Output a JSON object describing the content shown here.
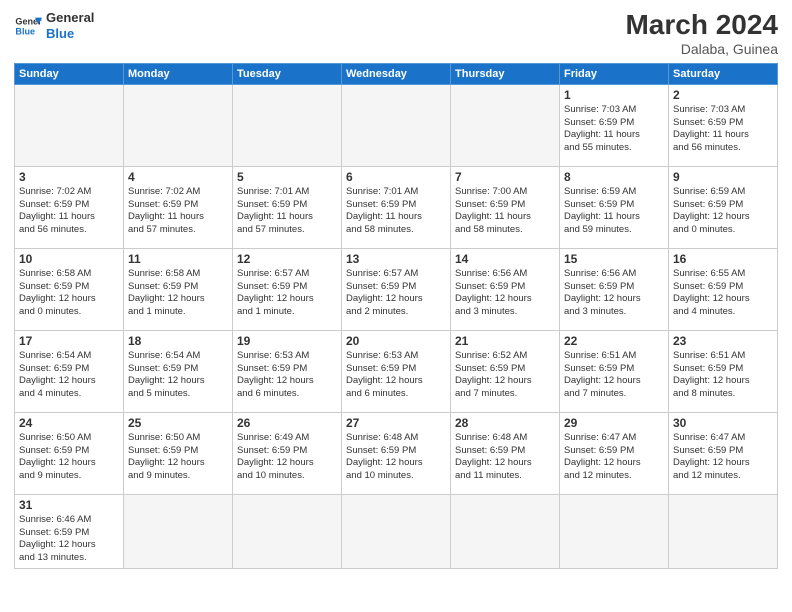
{
  "logo": {
    "general": "General",
    "blue": "Blue"
  },
  "title": "March 2024",
  "subtitle": "Dalaba, Guinea",
  "days_of_week": [
    "Sunday",
    "Monday",
    "Tuesday",
    "Wednesday",
    "Thursday",
    "Friday",
    "Saturday"
  ],
  "weeks": [
    [
      {
        "day": "",
        "info": ""
      },
      {
        "day": "",
        "info": ""
      },
      {
        "day": "",
        "info": ""
      },
      {
        "day": "",
        "info": ""
      },
      {
        "day": "",
        "info": ""
      },
      {
        "day": "1",
        "info": "Sunrise: 7:03 AM\nSunset: 6:59 PM\nDaylight: 11 hours\nand 55 minutes."
      },
      {
        "day": "2",
        "info": "Sunrise: 7:03 AM\nSunset: 6:59 PM\nDaylight: 11 hours\nand 56 minutes."
      }
    ],
    [
      {
        "day": "3",
        "info": "Sunrise: 7:02 AM\nSunset: 6:59 PM\nDaylight: 11 hours\nand 56 minutes."
      },
      {
        "day": "4",
        "info": "Sunrise: 7:02 AM\nSunset: 6:59 PM\nDaylight: 11 hours\nand 57 minutes."
      },
      {
        "day": "5",
        "info": "Sunrise: 7:01 AM\nSunset: 6:59 PM\nDaylight: 11 hours\nand 57 minutes."
      },
      {
        "day": "6",
        "info": "Sunrise: 7:01 AM\nSunset: 6:59 PM\nDaylight: 11 hours\nand 58 minutes."
      },
      {
        "day": "7",
        "info": "Sunrise: 7:00 AM\nSunset: 6:59 PM\nDaylight: 11 hours\nand 58 minutes."
      },
      {
        "day": "8",
        "info": "Sunrise: 6:59 AM\nSunset: 6:59 PM\nDaylight: 11 hours\nand 59 minutes."
      },
      {
        "day": "9",
        "info": "Sunrise: 6:59 AM\nSunset: 6:59 PM\nDaylight: 12 hours\nand 0 minutes."
      }
    ],
    [
      {
        "day": "10",
        "info": "Sunrise: 6:58 AM\nSunset: 6:59 PM\nDaylight: 12 hours\nand 0 minutes."
      },
      {
        "day": "11",
        "info": "Sunrise: 6:58 AM\nSunset: 6:59 PM\nDaylight: 12 hours\nand 1 minute."
      },
      {
        "day": "12",
        "info": "Sunrise: 6:57 AM\nSunset: 6:59 PM\nDaylight: 12 hours\nand 1 minute."
      },
      {
        "day": "13",
        "info": "Sunrise: 6:57 AM\nSunset: 6:59 PM\nDaylight: 12 hours\nand 2 minutes."
      },
      {
        "day": "14",
        "info": "Sunrise: 6:56 AM\nSunset: 6:59 PM\nDaylight: 12 hours\nand 3 minutes."
      },
      {
        "day": "15",
        "info": "Sunrise: 6:56 AM\nSunset: 6:59 PM\nDaylight: 12 hours\nand 3 minutes."
      },
      {
        "day": "16",
        "info": "Sunrise: 6:55 AM\nSunset: 6:59 PM\nDaylight: 12 hours\nand 4 minutes."
      }
    ],
    [
      {
        "day": "17",
        "info": "Sunrise: 6:54 AM\nSunset: 6:59 PM\nDaylight: 12 hours\nand 4 minutes."
      },
      {
        "day": "18",
        "info": "Sunrise: 6:54 AM\nSunset: 6:59 PM\nDaylight: 12 hours\nand 5 minutes."
      },
      {
        "day": "19",
        "info": "Sunrise: 6:53 AM\nSunset: 6:59 PM\nDaylight: 12 hours\nand 6 minutes."
      },
      {
        "day": "20",
        "info": "Sunrise: 6:53 AM\nSunset: 6:59 PM\nDaylight: 12 hours\nand 6 minutes."
      },
      {
        "day": "21",
        "info": "Sunrise: 6:52 AM\nSunset: 6:59 PM\nDaylight: 12 hours\nand 7 minutes."
      },
      {
        "day": "22",
        "info": "Sunrise: 6:51 AM\nSunset: 6:59 PM\nDaylight: 12 hours\nand 7 minutes."
      },
      {
        "day": "23",
        "info": "Sunrise: 6:51 AM\nSunset: 6:59 PM\nDaylight: 12 hours\nand 8 minutes."
      }
    ],
    [
      {
        "day": "24",
        "info": "Sunrise: 6:50 AM\nSunset: 6:59 PM\nDaylight: 12 hours\nand 9 minutes."
      },
      {
        "day": "25",
        "info": "Sunrise: 6:50 AM\nSunset: 6:59 PM\nDaylight: 12 hours\nand 9 minutes."
      },
      {
        "day": "26",
        "info": "Sunrise: 6:49 AM\nSunset: 6:59 PM\nDaylight: 12 hours\nand 10 minutes."
      },
      {
        "day": "27",
        "info": "Sunrise: 6:48 AM\nSunset: 6:59 PM\nDaylight: 12 hours\nand 10 minutes."
      },
      {
        "day": "28",
        "info": "Sunrise: 6:48 AM\nSunset: 6:59 PM\nDaylight: 12 hours\nand 11 minutes."
      },
      {
        "day": "29",
        "info": "Sunrise: 6:47 AM\nSunset: 6:59 PM\nDaylight: 12 hours\nand 12 minutes."
      },
      {
        "day": "30",
        "info": "Sunrise: 6:47 AM\nSunset: 6:59 PM\nDaylight: 12 hours\nand 12 minutes."
      }
    ],
    [
      {
        "day": "31",
        "info": "Sunrise: 6:46 AM\nSunset: 6:59 PM\nDaylight: 12 hours\nand 13 minutes."
      },
      {
        "day": "",
        "info": ""
      },
      {
        "day": "",
        "info": ""
      },
      {
        "day": "",
        "info": ""
      },
      {
        "day": "",
        "info": ""
      },
      {
        "day": "",
        "info": ""
      },
      {
        "day": "",
        "info": ""
      }
    ]
  ]
}
